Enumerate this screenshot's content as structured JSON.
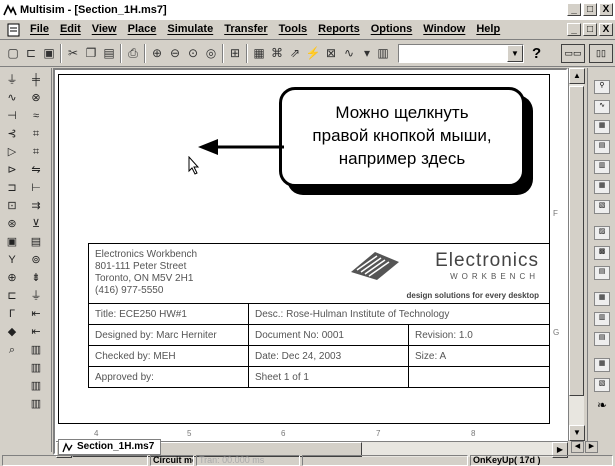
{
  "window": {
    "title": "Multisim - [Section_1H.ms7]",
    "controls": [
      "_",
      "□",
      "X"
    ],
    "child_controls": [
      "_",
      "□",
      "X"
    ]
  },
  "menu": [
    "File",
    "Edit",
    "View",
    "Place",
    "Simulate",
    "Transfer",
    "Tools",
    "Reports",
    "Options",
    "Window",
    "Help"
  ],
  "toolbar": {
    "icons": [
      "new-icon",
      "open-icon",
      "save-icon",
      "cut-icon",
      "copy-icon",
      "paste-icon",
      "print-icon",
      "zoom-in-icon",
      "zoom-out-icon",
      "zoom-area-icon",
      "zoom-fit-icon",
      "component-icon",
      "grapher-icon",
      "postprocessor-icon",
      "transfer-icon",
      "probe-icon",
      "analysis-icon",
      "list-icon"
    ],
    "combo_value": "",
    "help_glyph": "?"
  },
  "callout": {
    "line1": "Можно щелкнуть",
    "line2": "правой кнопкой мыши,",
    "line3": "например здесь"
  },
  "title_block": {
    "company_line1": "Electronics Workbench",
    "company_line2": "801-111 Peter Street",
    "company_line3": "Toronto, ON M5V 2H1",
    "company_line4": "(416) 977-5550",
    "logo_main": "Electronics",
    "logo_sub": "WORKBENCH",
    "logo_tag": "design solutions for every desktop",
    "title": "Title:   ECE250 HW#1",
    "desc": "Desc.: Rose-Hulman Institute of Technology",
    "designed_by": "Designed by:   Marc Herniter",
    "document_no": "Document No: 0001",
    "revision": "Revision: 1.0",
    "checked_by": "Checked by:    MEH",
    "date": "Date:  Dec 24, 2003",
    "size": "Size:       A",
    "approved_by": "Approved by:",
    "sheet": "Sheet   1    of   1"
  },
  "ruler": {
    "bottom": [
      "4",
      "5",
      "6",
      "7",
      "8"
    ],
    "right": [
      "F",
      "G"
    ]
  },
  "tabs": {
    "doc_tab": "Section_1H.ms7"
  },
  "status": {
    "message": "Circuit modified",
    "tran": "Tran: 00.000 ms",
    "onkey": "OnKeyUp( 17d )"
  }
}
